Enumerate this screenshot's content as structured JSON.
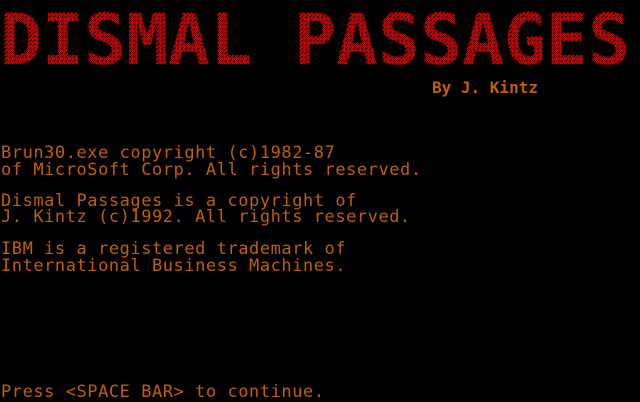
{
  "colors": {
    "background": "#000000",
    "title": "#c00000",
    "text": "#c06000"
  },
  "title": "DISMAL PASSAGES",
  "byline": "By J. Kintz",
  "credits": [
    "Brun30.exe copyright (c)1982-87",
    "of MicroSoft Corp. All rights reserved.",
    "Dismal Passages is a copyright of",
    "J. Kintz (c)1992. All rights reserved.",
    "IBM is a registered trademark of",
    "International Business Machines."
  ],
  "prompt": "Press <SPACE BAR> to continue."
}
